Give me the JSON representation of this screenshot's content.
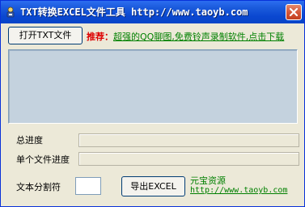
{
  "window": {
    "title": "TXT转换EXCEL文件工具  http://www.taoyb.com",
    "app_icon": "app-icon",
    "close_icon": "close-icon"
  },
  "toolbar": {
    "open_label": "打开TXT文件",
    "recommend_label": "推荐：",
    "recommend_link": "超强的QQ聊图,免费铃声录制软件,点击下载"
  },
  "progress": {
    "total_label": "总进度",
    "total_value": 0,
    "single_label": "单个文件进度",
    "single_value": 0
  },
  "separator": {
    "label": "文本分割符",
    "value": ""
  },
  "actions": {
    "export_label": "导出EXCEL"
  },
  "footer": {
    "brand": "元宝资源",
    "url": "http://www.taoyb.com"
  },
  "colors": {
    "titlebar": "#0a47d0",
    "recommend_red": "#dd0000",
    "link_green": "#008000",
    "main_area": "#c4d2de"
  }
}
